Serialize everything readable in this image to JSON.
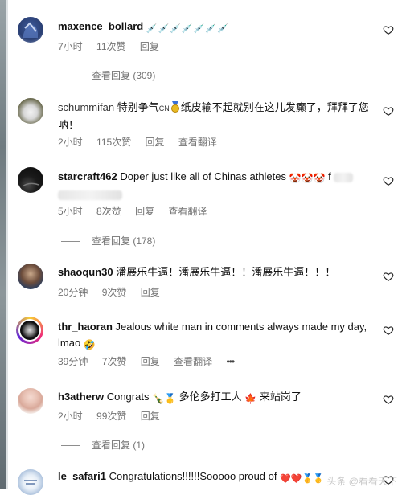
{
  "comments": [
    {
      "username": "maxence_bollard",
      "text": "",
      "emoji_row": "💉💉💉💉💉💉💉",
      "time": "7小时",
      "likes": "11次赞",
      "reply": "回复",
      "view_replies": "查看回复 (309)"
    },
    {
      "username": "schummifan",
      "text_a": "特别争气",
      "flag": "CN",
      "text_b": "纸皮输不起就别在这儿发癫了，拜拜了您呐！",
      "time": "2小时",
      "likes": "115次赞",
      "reply": "回复",
      "translate": "查看翻译"
    },
    {
      "username": "starcraft462",
      "text": "Doper just like all of Chinas athletes",
      "emoji_after": "🤡🤡🤡",
      "trailing": "f",
      "time": "5小时",
      "likes": "8次赞",
      "reply": "回复",
      "translate": "查看翻译",
      "view_replies": "查看回复 (178)"
    },
    {
      "username": "shaoqun30",
      "text": "潘展乐牛逼！潘展乐牛逼！！潘展乐牛逼！！！",
      "time": "20分钟",
      "likes": "9次赞",
      "reply": "回复"
    },
    {
      "username": "thr_haoran",
      "text": "Jealous white man in comments always made my day, lmao",
      "emoji_after": "🤣",
      "time": "39分钟",
      "likes": "7次赞",
      "reply": "回复",
      "translate": "查看翻译",
      "more": "•••"
    },
    {
      "username": "h3atherw",
      "text_a": "Congrats",
      "emoji_a": "🍾🥇",
      "text_b": "多伦多打工人",
      "emoji_b": "🍁",
      "text_c": "来站岗了",
      "time": "2小时",
      "likes": "99次赞",
      "reply": "回复",
      "view_replies": "查看回复 (1)"
    },
    {
      "username": "le_safari1",
      "text": "Congratulations!!!!!!Sooooo proud of",
      "emoji_row": "❤️❤️🥇🥇"
    }
  ],
  "watermark": "头条 @看看天下",
  "colors": {
    "meta": "#737373",
    "text": "#111111",
    "accent_red": "#d9304a"
  }
}
